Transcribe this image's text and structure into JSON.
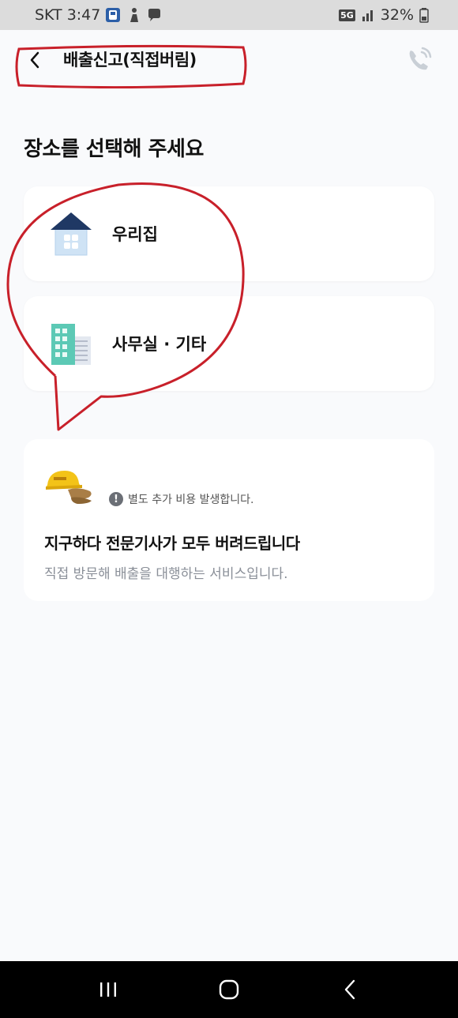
{
  "status": {
    "carrier_time": "SKT 3:47",
    "network": "5G",
    "battery": "32%"
  },
  "header": {
    "title": "배출신고(직접버림)"
  },
  "main": {
    "section_title": "장소를 선택해 주세요",
    "places": [
      {
        "label": "우리집",
        "icon": "house-icon"
      },
      {
        "label": "사무실 · 기타",
        "icon": "building-icon"
      }
    ],
    "service": {
      "notice": "별도 추가 비용 발생합니다.",
      "title": "지구하다 전문기사가 모두 버려드립니다",
      "description": "직접 방문해 배출을 대행하는 서비스입니다."
    }
  },
  "colors": {
    "annotation_red": "#c8202a",
    "house_roof": "#1f3864",
    "building_teal": "#5cc9b5",
    "desc_gray": "#8a8f98"
  }
}
